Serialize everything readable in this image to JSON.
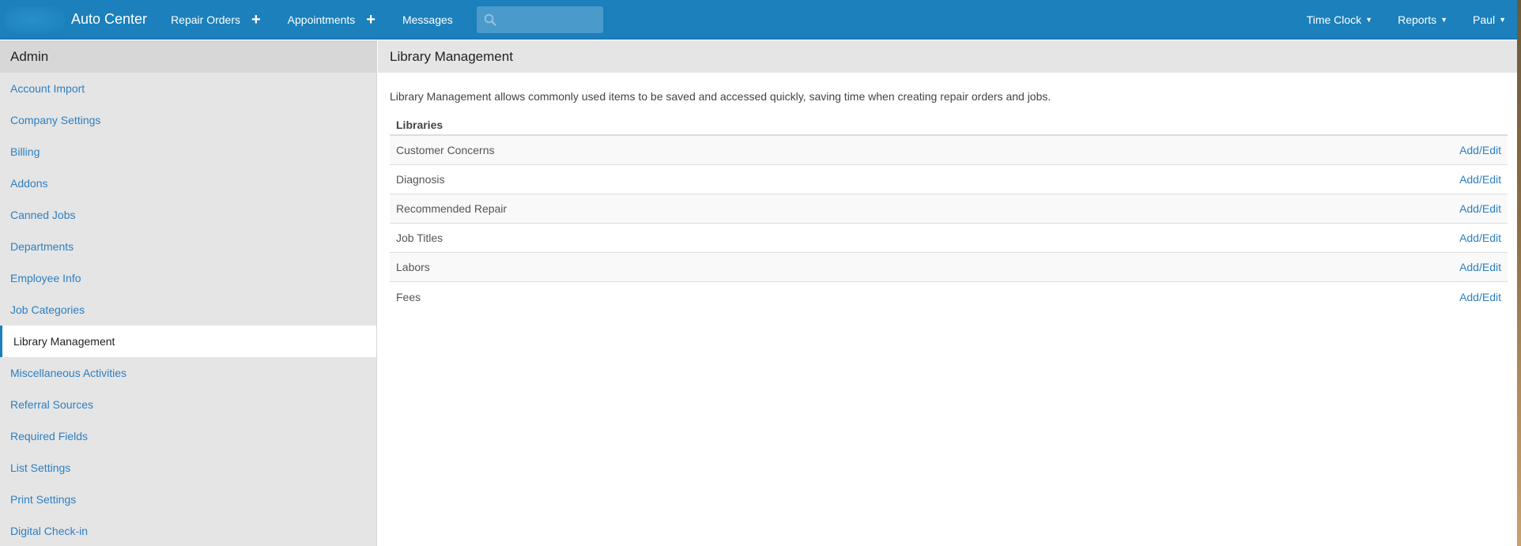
{
  "navbar": {
    "brand_name": "Auto Center",
    "items": [
      {
        "label": "Repair Orders"
      },
      {
        "label": "Appointments"
      },
      {
        "label": "Messages"
      }
    ],
    "search_placeholder": "",
    "right_items": [
      {
        "label": "Time Clock"
      },
      {
        "label": "Reports"
      },
      {
        "label": "Paul"
      }
    ],
    "icons": {
      "plus": "+",
      "caret": "▼"
    },
    "colors": {
      "navbar": "#1b80bb",
      "link": "#2d7fc1"
    }
  },
  "sidebar": {
    "header": "Admin",
    "items": [
      {
        "label": "Account Import"
      },
      {
        "label": "Company Settings"
      },
      {
        "label": "Billing"
      },
      {
        "label": "Addons"
      },
      {
        "label": "Canned Jobs"
      },
      {
        "label": "Departments"
      },
      {
        "label": "Employee Info"
      },
      {
        "label": "Job Categories"
      },
      {
        "label": "Library Management"
      },
      {
        "label": "Miscellaneous Activities"
      },
      {
        "label": "Referral Sources"
      },
      {
        "label": "Required Fields"
      },
      {
        "label": "List Settings"
      },
      {
        "label": "Print Settings"
      },
      {
        "label": "Digital Check-in"
      }
    ],
    "active_item": "Library Management"
  },
  "main": {
    "title": "Library Management",
    "description": "Library Management allows commonly used items to be saved and accessed quickly, saving time when creating repair orders and jobs.",
    "table": {
      "header": "Libraries",
      "rows": [
        {
          "name": "Customer Concerns",
          "action": "Add/Edit"
        },
        {
          "name": "Diagnosis",
          "action": "Add/Edit"
        },
        {
          "name": "Recommended Repair",
          "action": "Add/Edit"
        },
        {
          "name": "Job Titles",
          "action": "Add/Edit"
        },
        {
          "name": "Labors",
          "action": "Add/Edit"
        },
        {
          "name": "Fees",
          "action": "Add/Edit"
        }
      ]
    }
  }
}
